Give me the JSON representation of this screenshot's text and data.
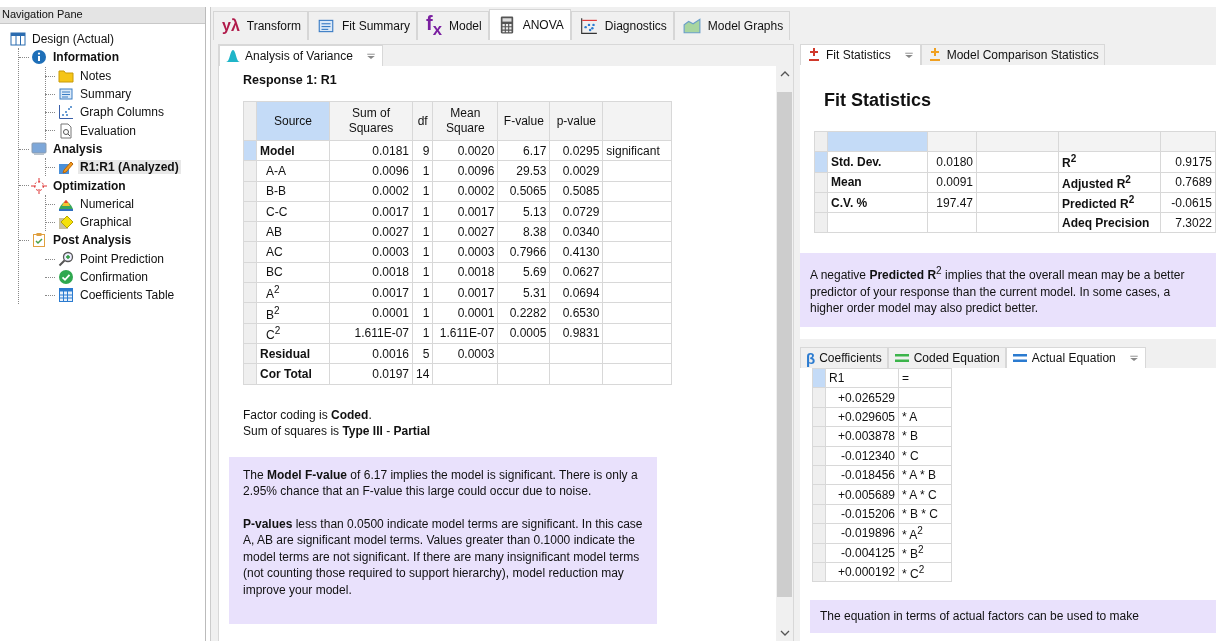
{
  "navigation_pane": {
    "title": "Navigation Pane",
    "tree": [
      {
        "label": "Design (Actual)",
        "selected": false,
        "children": [
          {
            "label": "Information",
            "selected": false,
            "children": [
              {
                "label": "Notes",
                "selected": false
              },
              {
                "label": "Summary",
                "selected": false
              },
              {
                "label": "Graph Columns",
                "selected": false
              },
              {
                "label": "Evaluation",
                "selected": false
              }
            ]
          },
          {
            "label": "Analysis",
            "selected": false,
            "children": [
              {
                "label": "R1:R1 (Analyzed)",
                "selected": true
              }
            ]
          },
          {
            "label": "Optimization",
            "selected": false,
            "children": [
              {
                "label": "Numerical",
                "selected": false
              },
              {
                "label": "Graphical",
                "selected": false
              }
            ]
          },
          {
            "label": "Post Analysis",
            "selected": false,
            "children": [
              {
                "label": "Point Prediction",
                "selected": false
              },
              {
                "label": "Confirmation",
                "selected": false
              },
              {
                "label": "Coefficients Table",
                "selected": false
              }
            ]
          }
        ]
      }
    ]
  },
  "tabs": [
    {
      "label": "Transform",
      "icon": "yλ",
      "selected": false
    },
    {
      "label": "Fit Summary",
      "selected": false
    },
    {
      "label": "Model",
      "icon": "f$_{x}$",
      "selected": false
    },
    {
      "label": "ANOVA",
      "selected": true
    },
    {
      "label": "Diagnostics",
      "selected": false
    },
    {
      "label": "Model Graphs",
      "selected": false
    }
  ],
  "anova_panel": {
    "tabs": [
      {
        "label": "Analysis of Variance",
        "selected": true
      }
    ],
    "heading": "Response 1: R1",
    "table": {
      "columns": [
        {
          "label": "Source",
          "selected": true
        },
        {
          "label": "Sum of Squares",
          "selected": false
        },
        {
          "label": "df",
          "selected": false
        },
        {
          "label": "Mean Square",
          "selected": false
        },
        {
          "label": "F-value",
          "selected": false
        },
        {
          "label": "p-value",
          "selected": false
        },
        {
          "selected": false
        }
      ],
      "rows": [
        {
          "kind": "total",
          "selected": true,
          "cells": [
            "Model",
            "0.0181",
            "9",
            "0.0020",
            "6.17",
            "0.0295",
            "significant"
          ]
        },
        {
          "kind": "term",
          "selected": false,
          "cells": [
            "A-A",
            "0.0096",
            "1",
            "0.0096",
            "29.53",
            "0.0029",
            null
          ]
        },
        {
          "kind": "term",
          "selected": false,
          "cells": [
            "B-B",
            "0.0002",
            "1",
            "0.0002",
            "0.5065",
            "0.5085",
            null
          ]
        },
        {
          "kind": "term",
          "selected": false,
          "cells": [
            "C-C",
            "0.0017",
            "1",
            "0.0017",
            "5.13",
            "0.0729",
            null
          ]
        },
        {
          "kind": "term",
          "selected": false,
          "cells": [
            "AB",
            "0.0027",
            "1",
            "0.0027",
            "8.38",
            "0.0340",
            null
          ]
        },
        {
          "kind": "term",
          "selected": false,
          "cells": [
            "AC",
            "0.0003",
            "1",
            "0.0003",
            "0.7966",
            "0.4130",
            null
          ]
        },
        {
          "kind": "term",
          "selected": false,
          "cells": [
            "BC",
            "0.0018",
            "1",
            "0.0018",
            "5.69",
            "0.0627",
            null
          ]
        },
        {
          "kind": "term",
          "selected": false,
          "cells": [
            "A$^{2}$",
            "0.0017",
            "1",
            "0.0017",
            "5.31",
            "0.0694",
            null
          ]
        },
        {
          "kind": "term",
          "selected": false,
          "cells": [
            "B$^{2}$",
            "0.0001",
            "1",
            "0.0001",
            "0.2282",
            "0.6530",
            null
          ]
        },
        {
          "kind": "term",
          "selected": false,
          "cells": [
            "C$^{2}$",
            "1.611E-07",
            "1",
            "1.611E-07",
            "0.0005",
            "0.9831",
            null
          ]
        },
        {
          "kind": "total",
          "selected": false,
          "cells": [
            "Residual",
            "0.0016",
            "5",
            "0.0003",
            null,
            null,
            null
          ]
        },
        {
          "kind": "total",
          "selected": false,
          "cells": [
            "Cor Total",
            "0.0197",
            "14",
            null,
            null,
            null,
            null
          ]
        }
      ]
    },
    "notes": [
      "Factor coding is **Coded**.",
      "Sum of squares is **Type III** - **Partial**"
    ],
    "remarks": [
      "The **Model F-value** of 6.17 implies the model is significant. There is only a 2.95% chance that an F-value this large could occur due to noise.",
      "**P-values** less than 0.0500 indicate model terms are significant. In this case A, AB are significant model terms. Values greater than 0.1000 indicate the model terms are not significant. If there are many insignificant model terms (not counting those required to support hierarchy), model reduction may improve your model."
    ]
  },
  "fit_panel": {
    "tabs": [
      {
        "label": "Fit Statistics",
        "selected": true
      },
      {
        "label": "Model Comparison Statistics",
        "selected": false
      }
    ],
    "heading": "Fit Statistics",
    "table": {
      "header_selected": true,
      "rows": [
        {
          "selected": true,
          "cells": [
            "Std. Dev.",
            "0.0180",
            null,
            "R$^{2}$",
            "0.9175"
          ]
        },
        {
          "selected": false,
          "cells": [
            "Mean",
            "0.0091",
            null,
            "Adjusted R$^{2}$",
            "0.7689"
          ]
        },
        {
          "selected": false,
          "cells": [
            "C.V. %",
            "197.47",
            null,
            "Predicted R$^{2}$",
            "-0.0615"
          ]
        },
        {
          "selected": false,
          "cells": [
            null,
            null,
            null,
            "Adeq Precision",
            "7.3022"
          ]
        }
      ]
    },
    "remark": "A negative **Predicted R**$^{2}$ implies that the overall mean may be a better predictor of your response than the current model. In some cases, a higher order model may also predict better."
  },
  "equation_panel": {
    "tabs": [
      {
        "label": "Coefficients",
        "icon": "β",
        "selected": false
      },
      {
        "label": "Coded Equation",
        "selected": false
      },
      {
        "label": "Actual Equation",
        "selected": true
      }
    ],
    "table": {
      "header": [
        "R1",
        "="
      ],
      "header_selected": true,
      "rows": [
        [
          "+0.026529",
          null
        ],
        [
          "+0.029605",
          "* A"
        ],
        [
          "+0.003878",
          "* B"
        ],
        [
          "-0.012340",
          "* C"
        ],
        [
          "-0.018456",
          "* A * B"
        ],
        [
          "+0.005689",
          "* A * C"
        ],
        [
          "-0.015206",
          "* B * C"
        ],
        [
          "-0.019896",
          "* A$^{2}$"
        ],
        [
          "-0.004125",
          "* B$^{2}$"
        ],
        [
          "+0.000192",
          "* C$^{2}$"
        ]
      ]
    },
    "remark": "The equation in terms of actual factors can be used to make"
  }
}
